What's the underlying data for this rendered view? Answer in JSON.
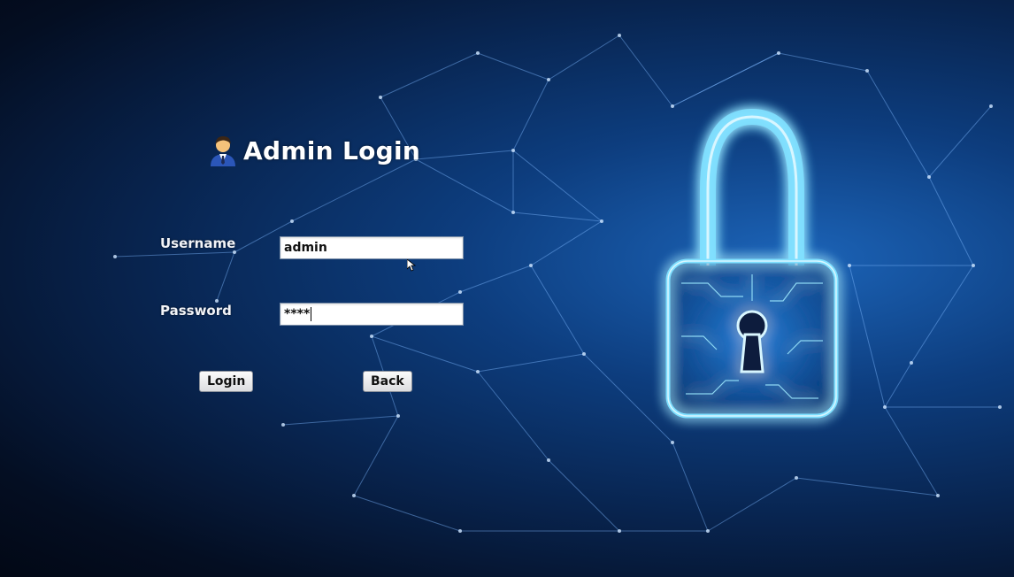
{
  "header": {
    "title": "Admin Login",
    "icon": "admin-person-icon"
  },
  "form": {
    "username_label": "Username",
    "username_value": "admin",
    "password_label": "Password",
    "password_mask": "****",
    "login_label": "Login",
    "back_label": "Back"
  },
  "colors": {
    "background_glow": "#1c64b8",
    "background_dark": "#020815",
    "lock_glow": "#5fd0ff"
  }
}
